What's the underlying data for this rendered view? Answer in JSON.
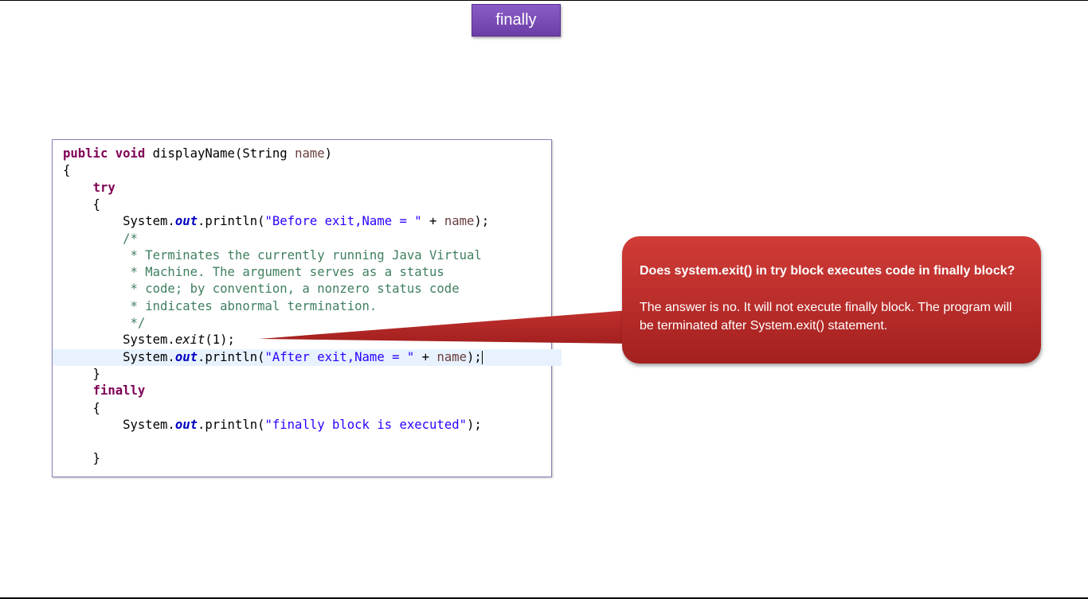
{
  "slide": {
    "title": "finally"
  },
  "code": {
    "lines": [
      [
        {
          "t": "public void ",
          "c": "kw"
        },
        {
          "t": "displayName(String ",
          "c": ""
        },
        {
          "t": "name",
          "c": "param"
        },
        {
          "t": ")",
          "c": ""
        }
      ],
      [
        {
          "t": "{",
          "c": ""
        }
      ],
      [
        {
          "t": "    ",
          "c": ""
        },
        {
          "t": "try",
          "c": "kw"
        }
      ],
      [
        {
          "t": "    {",
          "c": ""
        }
      ],
      [
        {
          "t": "        System.",
          "c": ""
        },
        {
          "t": "out",
          "c": "fld"
        },
        {
          "t": ".println(",
          "c": ""
        },
        {
          "t": "\"Before exit,Name = \"",
          "c": "str"
        },
        {
          "t": " + ",
          "c": ""
        },
        {
          "t": "name",
          "c": "param"
        },
        {
          "t": ");",
          "c": ""
        }
      ],
      [
        {
          "t": "        /*",
          "c": "cmt"
        }
      ],
      [
        {
          "t": "         * Terminates the currently running Java Virtual",
          "c": "cmt"
        }
      ],
      [
        {
          "t": "         * Machine. The argument serves as a status",
          "c": "cmt"
        }
      ],
      [
        {
          "t": "         * code; by convention, a nonzero status code",
          "c": "cmt"
        }
      ],
      [
        {
          "t": "         * indicates abnormal termination.",
          "c": "cmt"
        }
      ],
      [
        {
          "t": "         */",
          "c": "cmt"
        }
      ],
      [
        {
          "t": "        System.",
          "c": ""
        },
        {
          "t": "exit",
          "c": "mth"
        },
        {
          "t": "(1);",
          "c": ""
        }
      ],
      [
        {
          "t": "        System.",
          "c": ""
        },
        {
          "t": "out",
          "c": "fld"
        },
        {
          "t": ".println(",
          "c": ""
        },
        {
          "t": "\"After exit,Name = \"",
          "c": "str"
        },
        {
          "t": " + ",
          "c": ""
        },
        {
          "t": "name",
          "c": "param"
        },
        {
          "t": ");",
          "c": ""
        }
      ],
      [
        {
          "t": "    }",
          "c": ""
        }
      ],
      [
        {
          "t": "    ",
          "c": ""
        },
        {
          "t": "finally",
          "c": "kw"
        }
      ],
      [
        {
          "t": "    {",
          "c": ""
        }
      ],
      [
        {
          "t": "        System.",
          "c": ""
        },
        {
          "t": "out",
          "c": "fld"
        },
        {
          "t": ".println(",
          "c": ""
        },
        {
          "t": "\"finally block is executed\"",
          "c": "str"
        },
        {
          "t": ");",
          "c": ""
        }
      ],
      [
        {
          "t": "",
          "c": ""
        }
      ],
      [
        {
          "t": "    }",
          "c": ""
        }
      ]
    ],
    "highlighted_line": 12
  },
  "callout": {
    "question": "Does system.exit() in try block executes code in finally block?",
    "answer": "The answer is no. It will not execute finally block. The program will be terminated after System.exit() statement."
  },
  "colors": {
    "title_badge": "#7a4dba",
    "callout": "#c0302d",
    "keyword": "#7f0055",
    "string": "#2a00ff",
    "comment": "#3f7f5f",
    "field": "#0000c0"
  }
}
